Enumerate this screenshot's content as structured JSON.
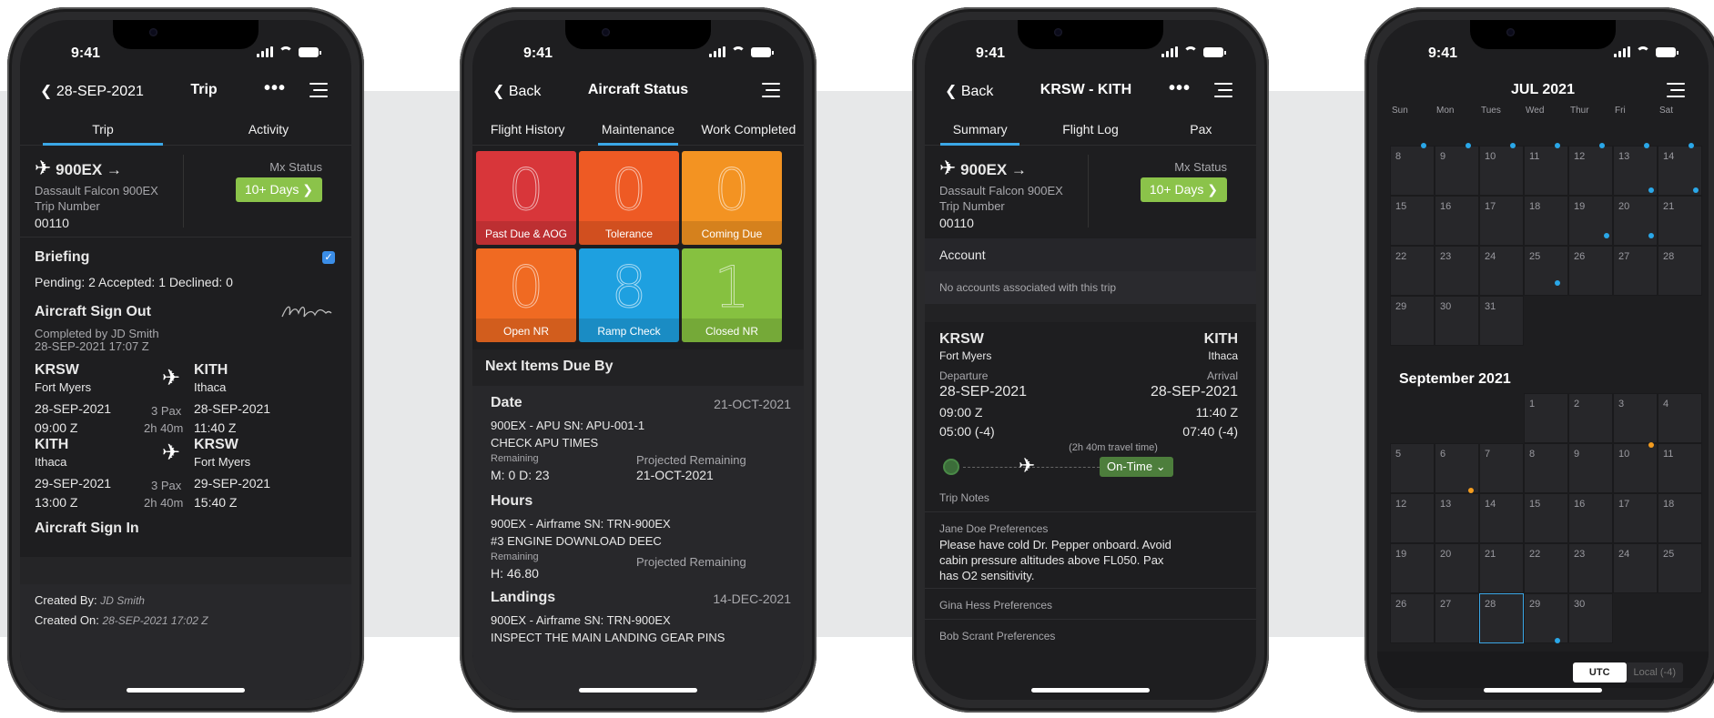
{
  "status_time": "9:41",
  "screen1": {
    "back_label": "28-SEP-2021",
    "title": "Trip",
    "more": "•••",
    "tabs": [
      "Trip",
      "Activity"
    ],
    "tail": "900EX →",
    "aircraft": "Dassault Falcon 900EX",
    "trip_number_label": "Trip Number",
    "trip_number": "00110",
    "mx_status_label": "Mx Status",
    "mx_button": "10+ Days",
    "briefing_title": "Briefing",
    "briefing_counts": "Pending: 2  Accepted: 1  Declined: 0",
    "signout_title": "Aircraft Sign Out",
    "signout_by": "Completed by JD Smith",
    "signout_time": "28-SEP-2021 17:07 Z",
    "legs": [
      {
        "from_code": "KRSW",
        "from_city": "Fort Myers",
        "to_code": "KITH",
        "to_city": "Ithaca",
        "dep_date": "28-SEP-2021",
        "dep_time": "09:00 Z",
        "pax": "3 Pax",
        "duration": "2h 40m",
        "arr_date": "28-SEP-2021",
        "arr_time": "11:40 Z"
      },
      {
        "from_code": "KITH",
        "from_city": "Ithaca",
        "to_code": "KRSW",
        "to_city": "Fort Myers",
        "dep_date": "29-SEP-2021",
        "dep_time": "13:00 Z",
        "pax": "3 Pax",
        "duration": "2h 40m",
        "arr_date": "29-SEP-2021",
        "arr_time": "15:40 Z"
      }
    ],
    "signin_title": "Aircraft Sign In",
    "created_by_label": "Created By:",
    "created_by": "JD Smith",
    "created_on_label": "Created On:",
    "created_on": "28-SEP-2021 17:02 Z"
  },
  "screen2": {
    "back_label": "Back",
    "title": "Aircraft Status",
    "tabs": [
      "Flight History",
      "Maintenance",
      "Work Completed"
    ],
    "tiles": [
      {
        "value": "0",
        "label": "Past Due & AOG",
        "color": "#d8363a"
      },
      {
        "value": "0",
        "label": "Tolerance",
        "color": "#ee5a24"
      },
      {
        "value": "0",
        "label": "Coming Due",
        "color": "#f39322"
      },
      {
        "value": "0",
        "label": "Open NR",
        "color": "#f06a22"
      },
      {
        "value": "8",
        "label": "Ramp Check",
        "color": "#1ea0e0"
      },
      {
        "value": "1",
        "label": "Closed NR",
        "color": "#86c140"
      }
    ],
    "next_items_title": "Next Items Due By",
    "items": [
      {
        "type": "Date",
        "date": "21-OCT-2021",
        "line1": "900EX - APU SN: APU-001-1",
        "line2": "CHECK APU TIMES",
        "remaining_label": "Remaining",
        "remaining": "M: 0 D: 23",
        "proj_label": "Projected Remaining",
        "proj": "21-OCT-2021"
      },
      {
        "type": "Hours",
        "date": "",
        "line1": "900EX - Airframe SN: TRN-900EX",
        "line2": "#3 ENGINE DOWNLOAD DEEC",
        "remaining_label": "Remaining",
        "remaining": "H: 46.80",
        "proj_label": "Projected Remaining",
        "proj": ""
      },
      {
        "type": "Landings",
        "date": "14-DEC-2021",
        "line1": "900EX - Airframe SN: TRN-900EX",
        "line2": "INSPECT THE MAIN LANDING GEAR PINS"
      }
    ]
  },
  "screen3": {
    "back_label": "Back",
    "title": "KRSW - KITH",
    "more": "•••",
    "tabs": [
      "Summary",
      "Flight Log",
      "Pax"
    ],
    "tail": "900EX →",
    "aircraft": "Dassault Falcon 900EX",
    "trip_number_label": "Trip Number",
    "trip_number": "00110",
    "mx_status_label": "Mx Status",
    "mx_button": "10+ Days",
    "account_title": "Account",
    "account_text": "No accounts associated with this trip",
    "from_code": "KRSW",
    "from_city": "Fort Myers",
    "to_code": "KITH",
    "to_city": "Ithaca",
    "departure_label": "Departure",
    "arrival_label": "Arrival",
    "dep_date": "28-SEP-2021",
    "arr_date": "28-SEP-2021",
    "dep_z": "09:00 Z",
    "arr_z": "11:40 Z",
    "dep_local": "05:00 (-4)",
    "arr_local": "07:40 (-4)",
    "travel_time": "(2h 40m travel time)",
    "ontime_label": "On-Time",
    "trip_notes": "Trip Notes",
    "pref1_title": "Jane Doe Preferences",
    "pref1_text": "Please have cold Dr. Pepper onboard.  Avoid cabin pressure altitudes above FL050.  Pax has O2 sensitivity.",
    "pref2_title": "Gina Hess Preferences",
    "pref3_title": "Bob Scrant Preferences"
  },
  "screen4": {
    "month_title": "JUL 2021",
    "weekdays": [
      "Sun",
      "Mon",
      "Tues",
      "Wed",
      "Thur",
      "Fri",
      "Sat"
    ],
    "july_rows": [
      [
        "8",
        "9",
        "10",
        "11",
        "12",
        "13",
        "14"
      ],
      [
        "15",
        "16",
        "17",
        "18",
        "19",
        "20",
        "21"
      ],
      [
        "22",
        "23",
        "24",
        "25",
        "26",
        "27",
        "28"
      ],
      [
        "29",
        "30",
        "31"
      ]
    ],
    "sept_title": "September 2021",
    "sept_rows": [
      [
        "",
        "",
        "",
        "1",
        "2",
        "3",
        "4"
      ],
      [
        "5",
        "6",
        "7",
        "8",
        "9",
        "10",
        "11"
      ],
      [
        "12",
        "13",
        "14",
        "15",
        "16",
        "17",
        "18"
      ],
      [
        "19",
        "20",
        "21",
        "22",
        "23",
        "24",
        "25"
      ],
      [
        "26",
        "27",
        "28",
        "29",
        "30"
      ]
    ],
    "utc_label": "UTC",
    "local_label": "Local (-4)",
    "dot_blue": "#2aa7e8",
    "dot_orange": "#f39c1f"
  }
}
